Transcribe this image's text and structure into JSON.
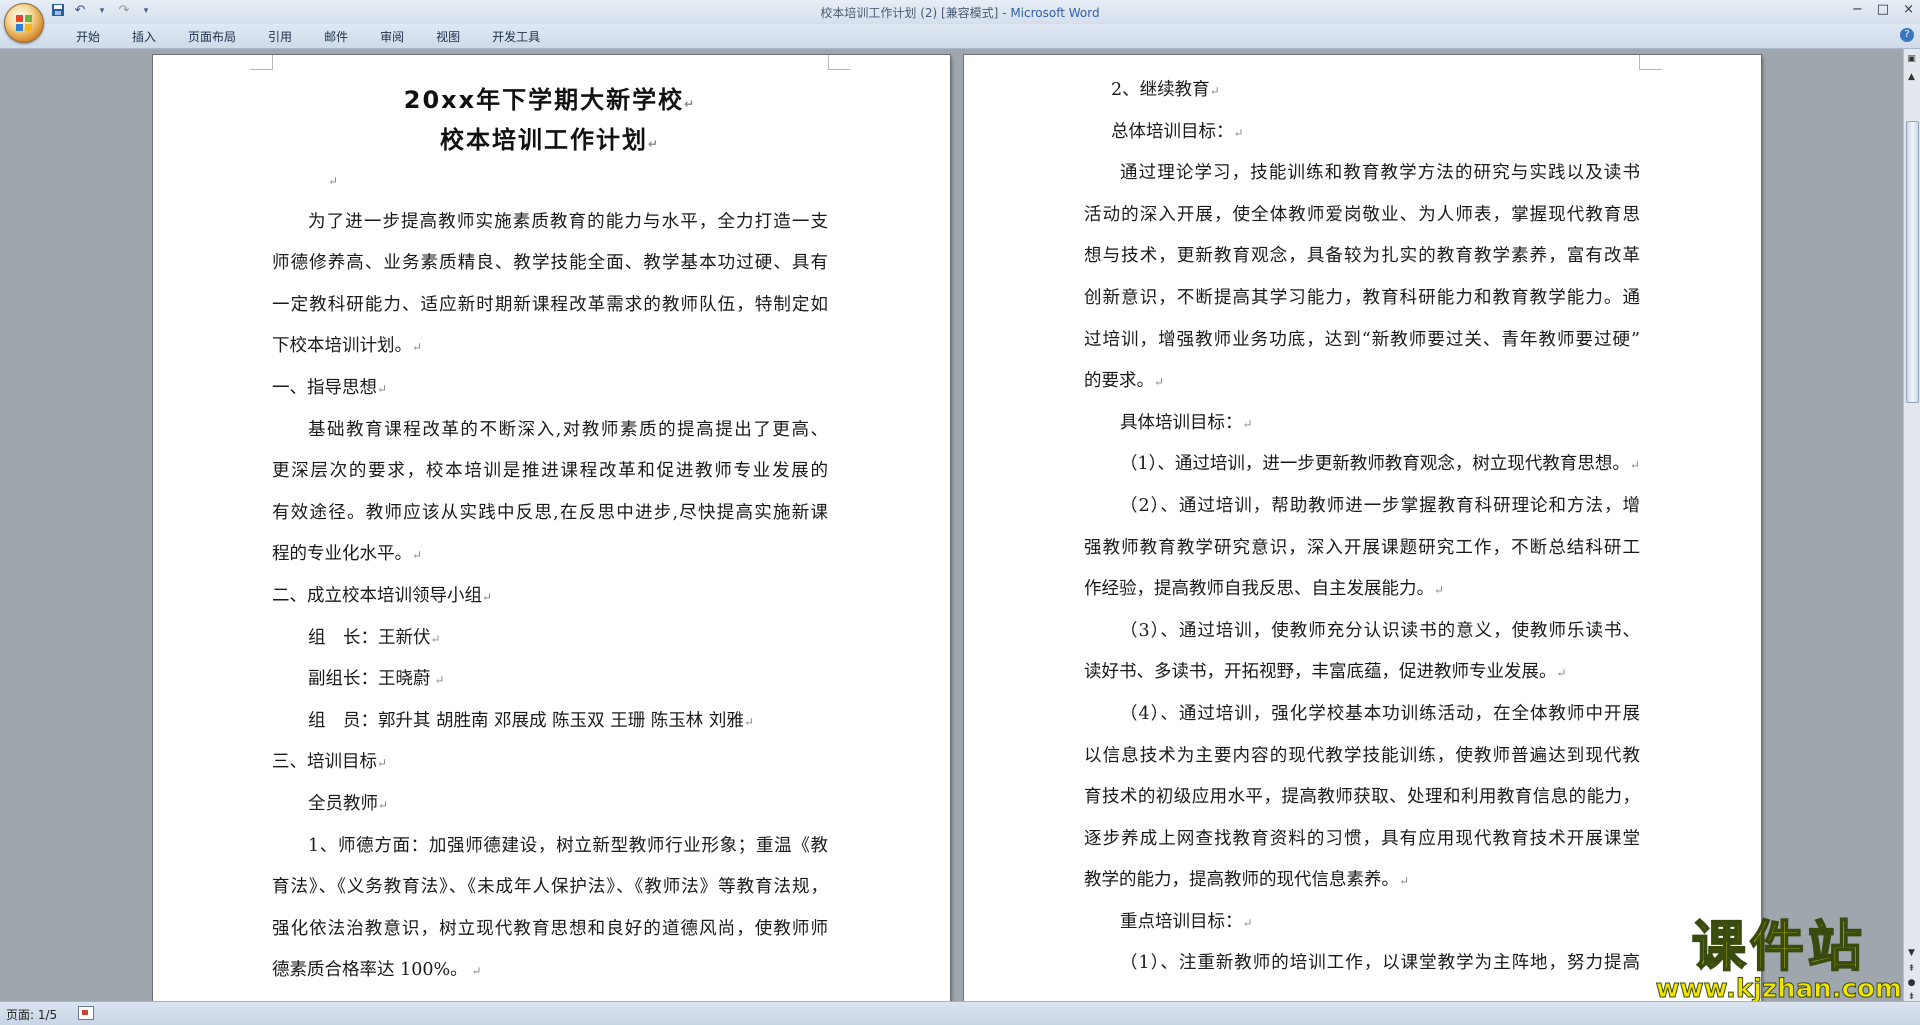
{
  "window": {
    "title": "校本培训工作计划 (2) [兼容模式] - ",
    "app_name": "Microsoft Word",
    "controls": [
      "−",
      "□",
      "×"
    ]
  },
  "qat": {
    "save_icon": "save-icon",
    "undo_icon": "undo-icon",
    "redo_icon": "redo-icon",
    "customize_icon": "dropdown-arrow-icon"
  },
  "ribbon": {
    "tabs": [
      "开始",
      "插入",
      "页面布局",
      "引用",
      "邮件",
      "审阅",
      "视图",
      "开发工具"
    ],
    "help": "?"
  },
  "left_page": {
    "title1": "20xx年下学期大新学校",
    "title2": "校本培训工作计划",
    "lines": [
      "为了进一步提高教师实施素质教育的能力与水平，全力打造一支",
      "师德修养高、业务素质精良、教学技能全面、教学基本功过硬、具有",
      "一定教科研能力、适应新时期新课程改革需求的教师队伍，特制定如",
      "下校本培训计划。",
      "一、指导思想",
      "基础教育课程改革的不断深入,对教师素质的提高提出了更高、",
      "更深层次的要求，校本培训是推进课程改革和促进教师专业发展的",
      "有效途径。教师应该从实践中反思,在反思中进步,尽快提高实施新课",
      "程的专业化水平。",
      "二、成立校本培训领导小组",
      "组　长：王新伏",
      "副组长：王晓蔚",
      "组　员：郭升其 胡胜南 邓展成 陈玉双 王珊 陈玉林 刘雅",
      "三、培训目标",
      "全员教师",
      "1、师德方面：加强师德建设，树立新型教师行业形象；重温《教",
      "育法》、《义务教育法》、《未成年人保护法》、《教师法》等教育法规，",
      "强化依法治教意识，树立现代教育思想和良好的道德风尚，使教师师",
      "德素质合格率达 100%。"
    ]
  },
  "right_page": {
    "lines": [
      "2、继续教育",
      "总体培训目标：",
      "通过理论学习，技能训练和教育教学方法的研究与实践以及读书",
      "活动的深入开展，使全体教师爱岗敬业、为人师表，掌握现代教育思",
      "想与技术，更新教育观念，具备较为扎实的教育教学素养，富有改革",
      "创新意识，不断提高其学习能力，教育科研能力和教育教学能力。通",
      "过培训，增强教师业务功底，达到“新教师要过关、青年教师要过硬”",
      "的要求。",
      "具体培训目标：",
      "（1）、通过培训，进一步更新教师教育观念，树立现代教育思想。",
      "（2）、通过培训，帮助教师进一步掌握教育科研理论和方法，增",
      "强教师教育教学研究意识，深入开展课题研究工作，不断总结科研工",
      "作经验，提高教师自我反思、自主发展能力。",
      "（3）、通过培训，使教师充分认识读书的意义，使教师乐读书、",
      "读好书、多读书，开拓视野，丰富底蕴，促进教师专业发展。",
      "（4）、通过培训，强化学校基本功训练活动，在全体教师中开展",
      "以信息技术为主要内容的现代教学技能训练，使教师普遍达到现代教",
      "育技术的初级应用水平，提高教师获取、处理和利用教育信息的能力，",
      "逐步养成上网查找教育资料的习惯，具有应用现代教育技术开展课堂",
      "教学的能力，提高教师的现代信息素养。",
      "重点培训目标：",
      "（1）、注重新教师的培训工作，以课堂教学为主阵地，努力提高"
    ]
  },
  "status": {
    "page": "页面: 1/5"
  },
  "watermark": {
    "big": "课件站",
    "small": "www.kjzhan.com"
  }
}
